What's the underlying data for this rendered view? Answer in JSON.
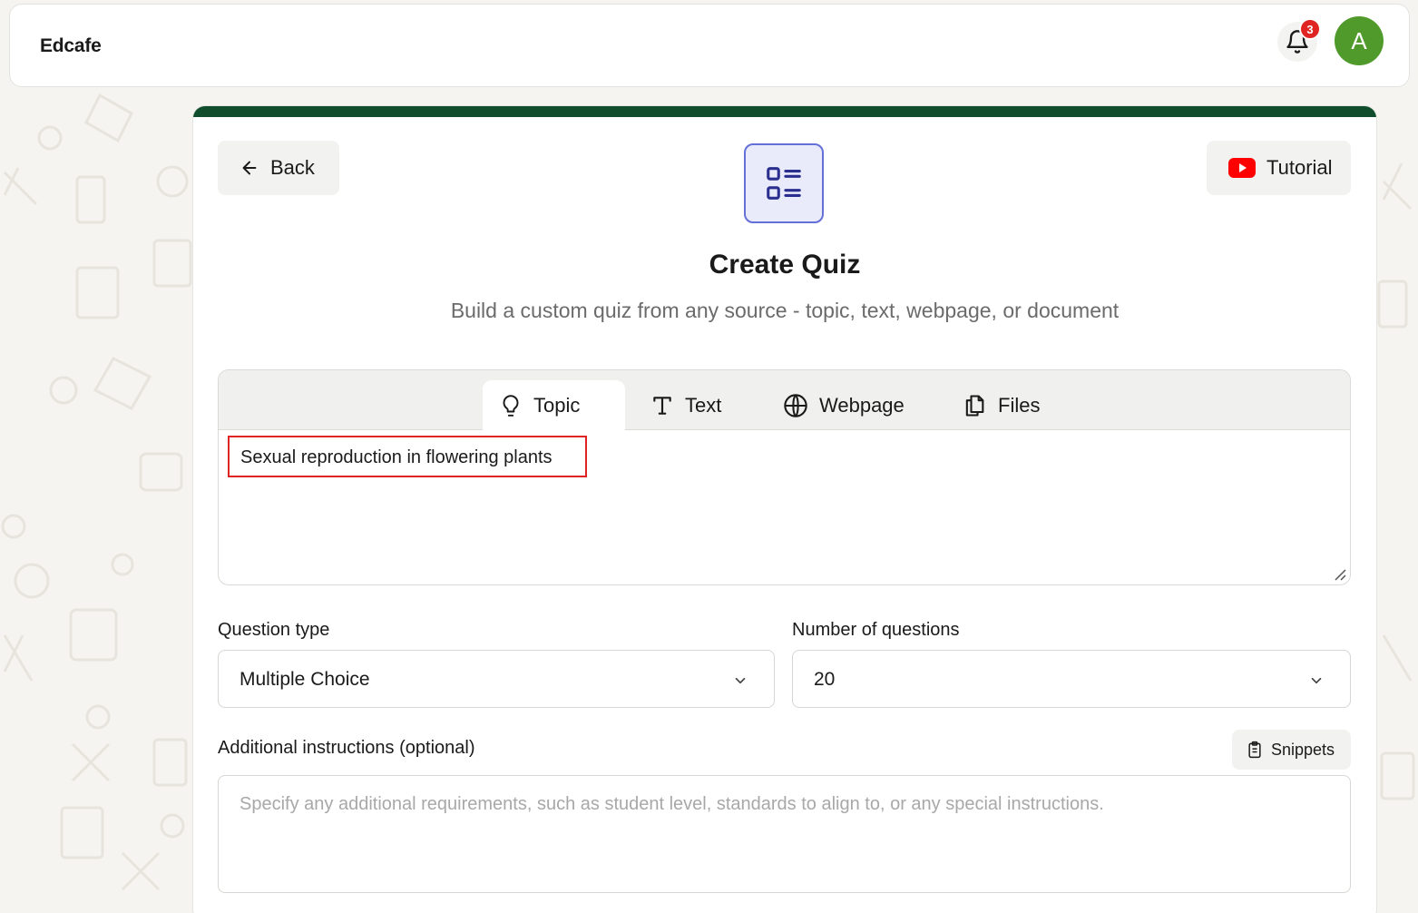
{
  "header": {
    "brand": "Edcafe",
    "notification_count": "3",
    "avatar_initial": "A"
  },
  "card": {
    "back_label": "Back",
    "tutorial_label": "Tutorial",
    "title": "Create Quiz",
    "subtitle": "Build a custom quiz from any source - topic, text, webpage, or document"
  },
  "source_tabs": [
    {
      "label": "Topic",
      "icon": "lightbulb-icon",
      "active": true
    },
    {
      "label": "Text",
      "icon": "text-icon",
      "active": false
    },
    {
      "label": "Webpage",
      "icon": "globe-icon",
      "active": false
    },
    {
      "label": "Files",
      "icon": "files-icon",
      "active": false
    }
  ],
  "topic_input": {
    "value": "Sexual reproduction in flowering plants"
  },
  "question_type": {
    "label": "Question type",
    "value": "Multiple Choice"
  },
  "num_questions": {
    "label": "Number of questions",
    "value": "20"
  },
  "instructions": {
    "label": "Additional instructions (optional)",
    "snippets_label": "Snippets",
    "placeholder": "Specify any additional requirements, such as student level, standards to align to, or any special instructions."
  },
  "colors": {
    "accent_bar": "#0f4d2d",
    "avatar": "#4f9a2a",
    "badge": "#e02424",
    "quiz_icon": "#2a2f8f",
    "highlight_border": "#e02424"
  }
}
